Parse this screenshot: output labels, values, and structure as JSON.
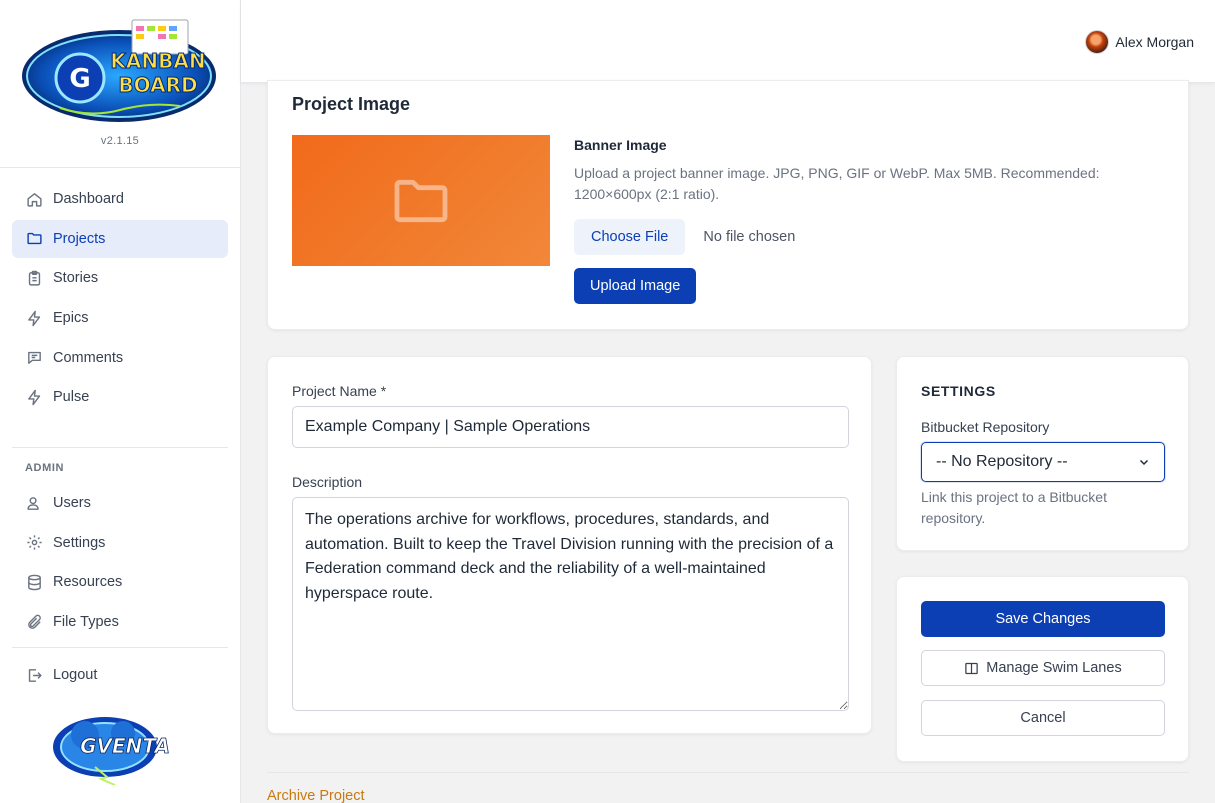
{
  "sidebar": {
    "logo_text": "KANBAN BOARD",
    "version": "v2.1.15",
    "nav": [
      {
        "label": "Dashboard",
        "icon": "home-icon"
      },
      {
        "label": "Projects",
        "icon": "folder-icon",
        "active": true
      },
      {
        "label": "Stories",
        "icon": "clipboard-icon"
      },
      {
        "label": "Epics",
        "icon": "lightning-icon"
      },
      {
        "label": "Comments",
        "icon": "comment-icon"
      },
      {
        "label": "Pulse",
        "icon": "lightning-icon"
      }
    ],
    "admin_label": "ADMIN",
    "admin_nav": [
      {
        "label": "Users",
        "icon": "users-icon"
      },
      {
        "label": "Settings",
        "icon": "gear-icon"
      },
      {
        "label": "Resources",
        "icon": "database-icon"
      },
      {
        "label": "File Types",
        "icon": "paperclip-icon"
      }
    ],
    "logout_label": "Logout",
    "footer_logo_text": "GVENTA"
  },
  "header": {
    "user_name": "Alex Morgan"
  },
  "image_card": {
    "title": "Project Image",
    "banner_label": "Banner Image",
    "help": "Upload a project banner image. JPG, PNG, GIF or WebP. Max 5MB. Recommended: 1200×600px (2:1 ratio).",
    "choose_file": "Choose File",
    "no_file": "No file chosen",
    "upload": "Upload Image"
  },
  "form": {
    "name_label": "Project Name *",
    "name_value": "Example Company | Sample Operations",
    "description_label": "Description",
    "description_value": "The operations archive for workflows, procedures, standards, and automation. Built to keep the Travel Division running with the precision of a Federation command deck and the reliability of a well-maintained hyperspace route."
  },
  "settings": {
    "title": "SETTINGS",
    "repo_label": "Bitbucket Repository",
    "repo_value": "-- No Repository --",
    "repo_help": "Link this project to a Bitbucket repository."
  },
  "actions": {
    "save": "Save Changes",
    "swim_lanes": "Manage Swim Lanes",
    "cancel": "Cancel"
  },
  "archive_label": "Archive Project",
  "colors": {
    "primary": "#0b3fb3",
    "banner": "#f26a1b",
    "archive": "#c77a10"
  }
}
